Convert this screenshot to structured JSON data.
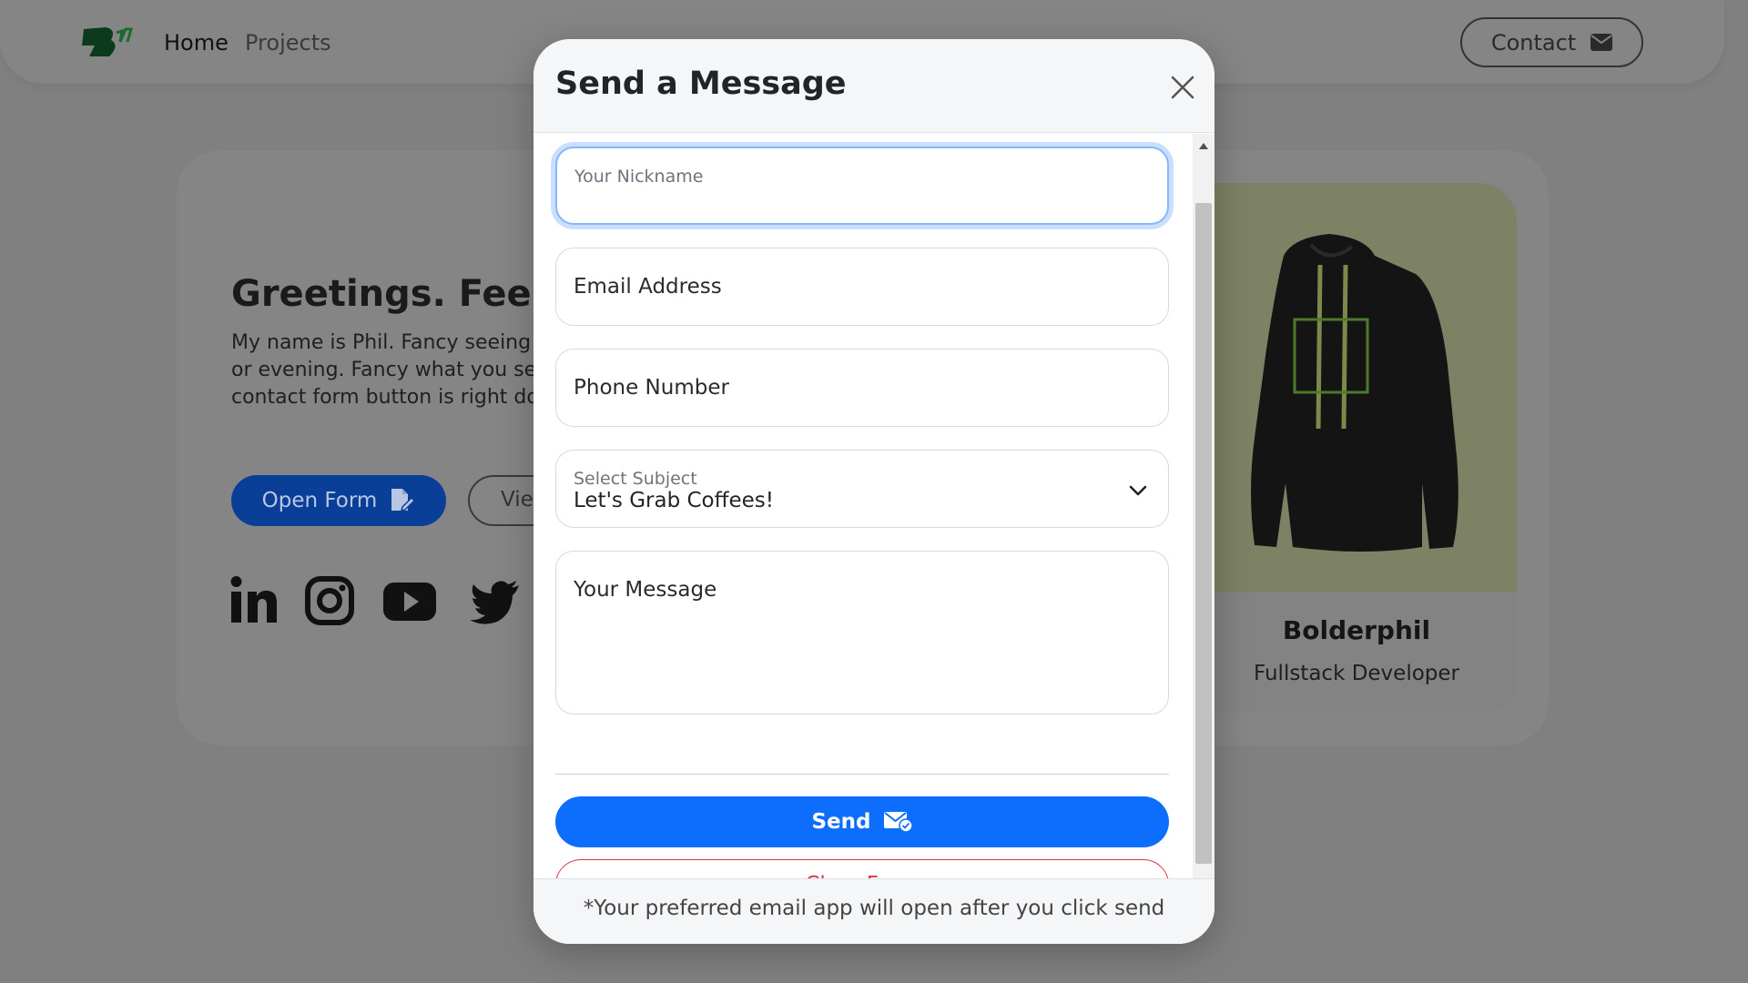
{
  "nav": {
    "home_label": "Home",
    "projects_label": "Projects",
    "contact_label": "Contact"
  },
  "hero": {
    "title": "Greetings. Feel Fr",
    "lines": [
      "My name is Phil. Fancy seeing",
      "or evening. Fancy what you se",
      "contact form button is right dow"
    ],
    "open_form_label": "Open Form",
    "view_label": "Vie"
  },
  "social": {
    "icons": [
      "linkedin-icon",
      "instagram-icon",
      "youtube-icon",
      "twitter-icon"
    ]
  },
  "profile": {
    "name": "Bolderphil",
    "role": "Fullstack Developer"
  },
  "modal": {
    "title": "Send a Message",
    "nickname_placeholder": "Your Nickname",
    "email_placeholder": "Email Address",
    "phone_placeholder": "Phone Number",
    "subject_label": "Select Subject",
    "subject_value": "Let's Grab Coffees!",
    "message_placeholder": "Your Message",
    "send_label": "Send",
    "clear_label": "Clear Form",
    "footer_note": "*Your preferred email app will open after you click send"
  },
  "colors": {
    "primary": "#0d6efd",
    "danger": "#dc3545",
    "focus_ring": "#86b7fe",
    "overlay_bg": "#808080"
  }
}
